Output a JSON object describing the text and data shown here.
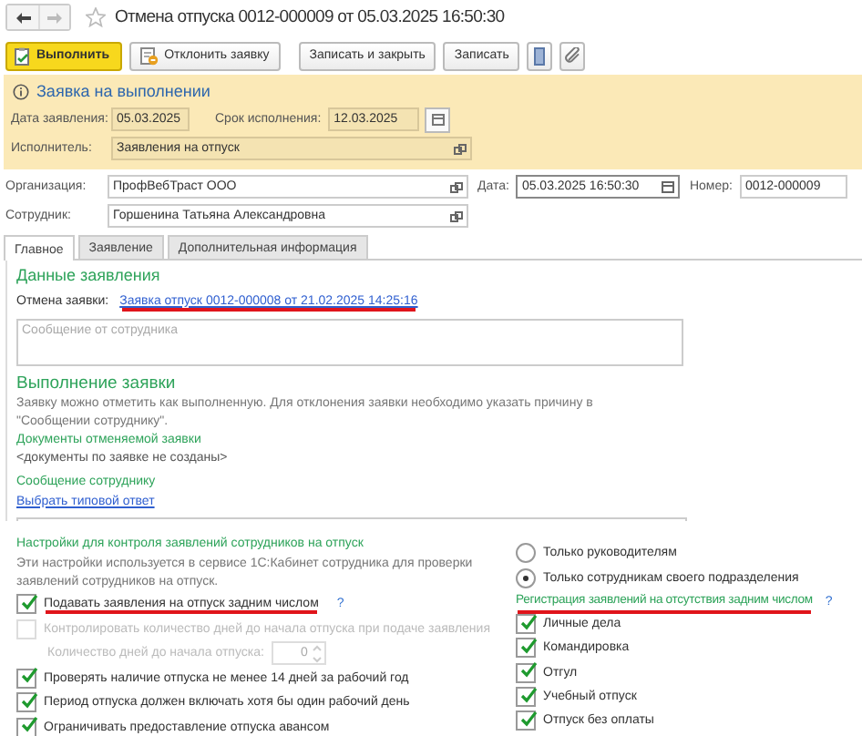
{
  "window": {
    "title": "Отмена отпуска 0012-000009 от 05.03.2025 16:50:30"
  },
  "toolbar": [
    {
      "kind": "primary",
      "label": "Выполнить"
    },
    {
      "kind": "reject",
      "label": "Отклонить заявку"
    },
    {
      "kind": "text",
      "label": "Записать и закрыть"
    },
    {
      "kind": "text",
      "label": "Записать"
    },
    {
      "kind": "report"
    },
    {
      "kind": "attach"
    }
  ],
  "status_panel": {
    "title": "Заявка на выполнении",
    "request_date": {
      "label": "Дата заявления:",
      "value": "05.03.2025"
    },
    "due_date": {
      "label": "Срок исполнения:",
      "value": "12.03.2025"
    },
    "executor": {
      "label": "Исполнитель:",
      "value": "Заявления на отпуск"
    }
  },
  "header": {
    "organization": {
      "label": "Организация:",
      "value": "ПрофВебТраст ООО"
    },
    "date": {
      "label": "Дата:",
      "value": "05.03.2025 16:50:30"
    },
    "number": {
      "label": "Номер:",
      "value": "0012-000009"
    },
    "employee": {
      "label": "Сотрудник:",
      "value": "Горшенина Татьяна Александровна"
    }
  },
  "tabs": [
    {
      "label": "Главное",
      "selected": true
    },
    {
      "label": "Заявление",
      "selected": false
    },
    {
      "label": "Дополнительная информация",
      "selected": false
    }
  ],
  "main_tab": {
    "request_heading": "Данные заявления",
    "cancel_label": "Отмена заявки:",
    "cancel_link": "Заявка отпуск 0012-000008 от 21.02.2025 14:25:16",
    "cancel_highlighted": true,
    "message_placeholder": "Сообщение от сотрудника",
    "execution_heading": "Выполнение заявки",
    "execution_note": "Заявку можно отметить как выполненную. Для отклонения заявки необходимо указать причину в \"Сообщении сотруднику\".",
    "documents_heading": "Документы отменяемой заявки",
    "documents_note": "<документы по заявке не созданы>",
    "reply_heading": "Сообщение сотруднику",
    "reply_link": "Выбрать типовой ответ"
  },
  "settings": {
    "title": "Настройки для контроля заявлений сотрудников на отпуск",
    "description": "Эти настройки используется в сервисе 1С:Кабинет сотрудника для проверки заявлений сотрудников на отпуск.",
    "options": [
      {
        "kind": "checkbox",
        "label": "Подавать заявления на отпуск задним числом",
        "checked": true,
        "disabled": false,
        "highlighted": true,
        "help": "?"
      },
      {
        "kind": "checkbox",
        "label": "Контролировать количество дней до начала отпуска при подаче заявления",
        "checked": false,
        "disabled": true,
        "highlighted": false
      },
      {
        "kind": "number",
        "label": "Количество дней до начала отпуска:",
        "value": "0",
        "disabled": true
      },
      {
        "kind": "checkbox",
        "label": "Проверять наличие отпуска не менее 14 дней за рабочий год",
        "checked": true,
        "disabled": false,
        "highlighted": false
      },
      {
        "kind": "checkbox",
        "label": "Период отпуска должен включать хотя бы один рабочий день",
        "checked": true,
        "disabled": false,
        "highlighted": false
      },
      {
        "kind": "checkbox",
        "label": "Ограничивать предоставление отпуска авансом",
        "checked": true,
        "disabled": false,
        "highlighted": false
      }
    ],
    "audience": [
      {
        "label": "Только руководителям",
        "selected": false
      },
      {
        "label": "Только сотрудникам своего подразделения",
        "selected": true
      }
    ],
    "absence_heading": "Регистрация заявлений на отсутствия задним числом",
    "absence_help": "?",
    "absence_highlighted": true,
    "absence_types": [
      {
        "label": "Личные дела",
        "checked": true
      },
      {
        "label": "Командировка",
        "checked": true
      },
      {
        "label": "Отгул",
        "checked": true
      },
      {
        "label": "Учебный отпуск",
        "checked": true
      },
      {
        "label": "Отпуск без оплаты",
        "checked": true
      }
    ]
  }
}
